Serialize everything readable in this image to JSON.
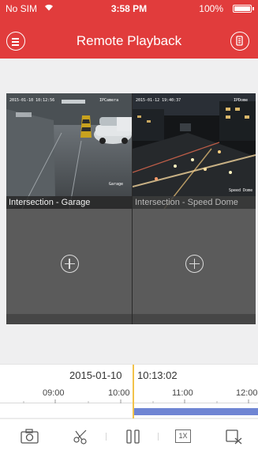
{
  "status_bar": {
    "carrier": "No SIM",
    "time": "3:58 PM",
    "battery": "100%"
  },
  "header": {
    "title": "Remote Playback"
  },
  "cameras": [
    {
      "label": "Intersection - Garage",
      "osd_time": "2015-01-10 10:12:56",
      "osd_name": "IPCamera",
      "osd_corner": "Garage",
      "selected": true
    },
    {
      "label": "Intersection - Speed Dome",
      "osd_time": "2015-01-12 19:40:37",
      "osd_name": "IPDome",
      "osd_corner": "Speed Dome",
      "selected": false
    }
  ],
  "timeline": {
    "date": "2015-01-10",
    "time": "10:13:02",
    "hours": [
      "09:00",
      "10:00",
      "11:00",
      "12:00"
    ],
    "bar_color": "#6f85d3",
    "cursor_color": "#f2c24a"
  },
  "toolbar": {
    "speed_label": "1X",
    "icons": [
      "camera-icon",
      "scissors-icon",
      "pause-icon",
      "speed-icon",
      "stop-icon"
    ]
  },
  "colors": {
    "accent": "#e13c3c",
    "selected_border": "#d9a64a"
  }
}
